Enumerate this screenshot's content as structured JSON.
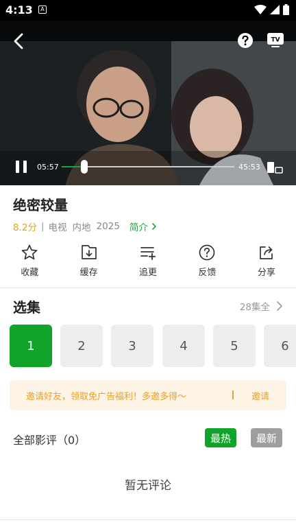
{
  "status_bar": {
    "time": "4:13",
    "app_icon": "A"
  },
  "player": {
    "current_time": "05:57",
    "total_time": "45:53",
    "progress_fraction": 0.1298
  },
  "show": {
    "title": "绝密较量",
    "score": "8.2分",
    "separator": "|",
    "type": "电视",
    "region": "内地",
    "year": "2025",
    "intro_label": "简介"
  },
  "actions": [
    {
      "id": "collect",
      "label": "收藏",
      "icon": "star-icon"
    },
    {
      "id": "cache",
      "label": "缓存",
      "icon": "download-icon"
    },
    {
      "id": "follow",
      "label": "追更",
      "icon": "playlist-add-icon"
    },
    {
      "id": "feedback",
      "label": "反馈",
      "icon": "question-icon"
    },
    {
      "id": "share",
      "label": "分享",
      "icon": "share-icon"
    }
  ],
  "episodes": {
    "title": "选集",
    "all_label": "28集全",
    "items": [
      "1",
      "2",
      "3",
      "4",
      "5",
      "6"
    ],
    "selected": "1"
  },
  "invite": {
    "text": "邀请好友，领取免广告福利！多邀多得～",
    "button": "邀请"
  },
  "reviews": {
    "title": "全部影评（0）",
    "sort_hot": "最热",
    "sort_new": "最新",
    "empty_text": "暂无评论"
  },
  "colors": {
    "accent_green": "#12a32a",
    "score_orange": "#e2a21b",
    "invite_bg": "#fdf4e6",
    "invite_text": "#e8a02c"
  }
}
